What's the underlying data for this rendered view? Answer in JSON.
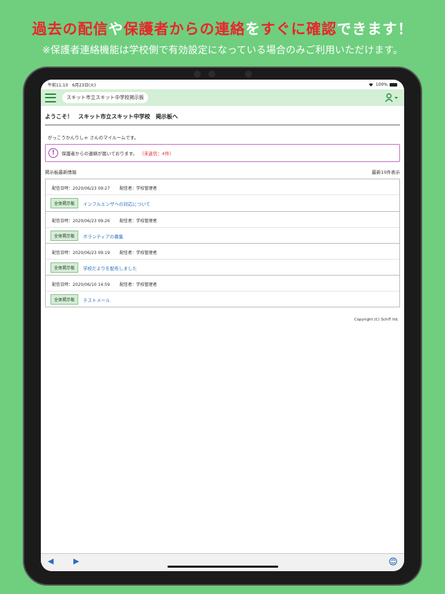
{
  "promo": {
    "line1": [
      {
        "text": "過去の配信",
        "highlight": true
      },
      {
        "text": "や",
        "highlight": false
      },
      {
        "text": "保護者からの連絡",
        "highlight": true
      },
      {
        "text": "を",
        "highlight": false
      },
      {
        "text": "すぐに確認",
        "highlight": true
      },
      {
        "text": "できます！",
        "highlight": false
      }
    ],
    "line2": "※保護者連絡機能は学校側で有効設定になっている場合のみご利用いただけます。"
  },
  "statusbar": {
    "time_date": "午前11:10　6月23日(火)",
    "battery": "100%"
  },
  "navbar": {
    "school_name": "スキット市立スキット中学校掲示板"
  },
  "welcome": "ようこそ！　スキット市立スキット中学校　掲示板へ",
  "greeting": "がっこうかんりしゃ さんのマイルームです。",
  "alert": {
    "message": "保護者からの連絡が届いております。",
    "unread": "（未返信：4件）"
  },
  "board": {
    "section_title": "掲示板最新情報",
    "count_label": "最新10件表示",
    "posts": [
      {
        "datetime": "配信日時：2020/06/23 09:27",
        "sender": "配信者：学校管理者",
        "badge": "全体掲示板",
        "title": "インフルエンザへの対応について"
      },
      {
        "datetime": "配信日時：2020/06/23 09:26",
        "sender": "配信者：学校管理者",
        "badge": "全体掲示板",
        "title": "ボランティアの募集"
      },
      {
        "datetime": "配信日時：2020/06/23 09:19",
        "sender": "配信者：学校管理者",
        "badge": "全体掲示板",
        "title": "学校だよりを配布しました"
      },
      {
        "datetime": "配信日時：2020/06/10 14:59",
        "sender": "配信者：学校管理者",
        "badge": "全体掲示板",
        "title": "テストメール"
      }
    ]
  },
  "copyright": "Copyright (C) SchIT ltd.",
  "colors": {
    "background": "#6fcf7e",
    "highlight": "#e8262b",
    "navbar": "#d3efd5",
    "link": "#2a6fbf"
  }
}
